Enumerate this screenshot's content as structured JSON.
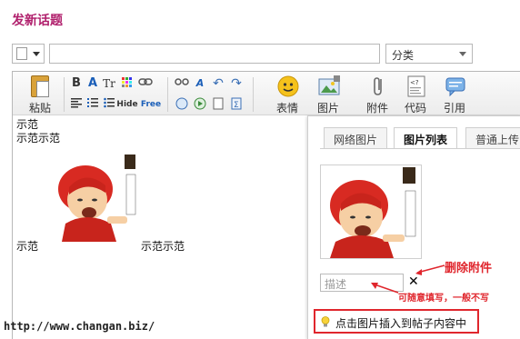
{
  "page": {
    "title": "发新话题"
  },
  "form": {
    "category": "分类"
  },
  "toolbar": {
    "paste_label": "粘贴",
    "buttons": [
      {
        "icon": "smiley-icon",
        "label": "表情"
      },
      {
        "icon": "image-icon",
        "label": "图片"
      },
      {
        "icon": "paperclip-icon",
        "label": "附件"
      },
      {
        "icon": "code-icon",
        "label": "代码"
      },
      {
        "icon": "quote-icon",
        "label": "引用"
      }
    ],
    "small": {
      "bold": "B",
      "font": "A",
      "size": "Tr",
      "hide": "Hide",
      "free": "Free"
    }
  },
  "editor": {
    "line1": "示范",
    "line2": "示范示范",
    "before_image": "示范",
    "after_image": "示范示范"
  },
  "panel": {
    "tabs": [
      "网络图片",
      "图片列表",
      "普通上传"
    ],
    "active_tab": 1,
    "desc_placeholder": "描述",
    "delete_label": "删除附件",
    "note": "可随意填写，一般不写",
    "hint": "点击图片插入到帖子内容中"
  },
  "watermark": "http://www.changan.biz/",
  "colors": {
    "title": "#b01f6c",
    "annotation_red": "#e0262d"
  }
}
